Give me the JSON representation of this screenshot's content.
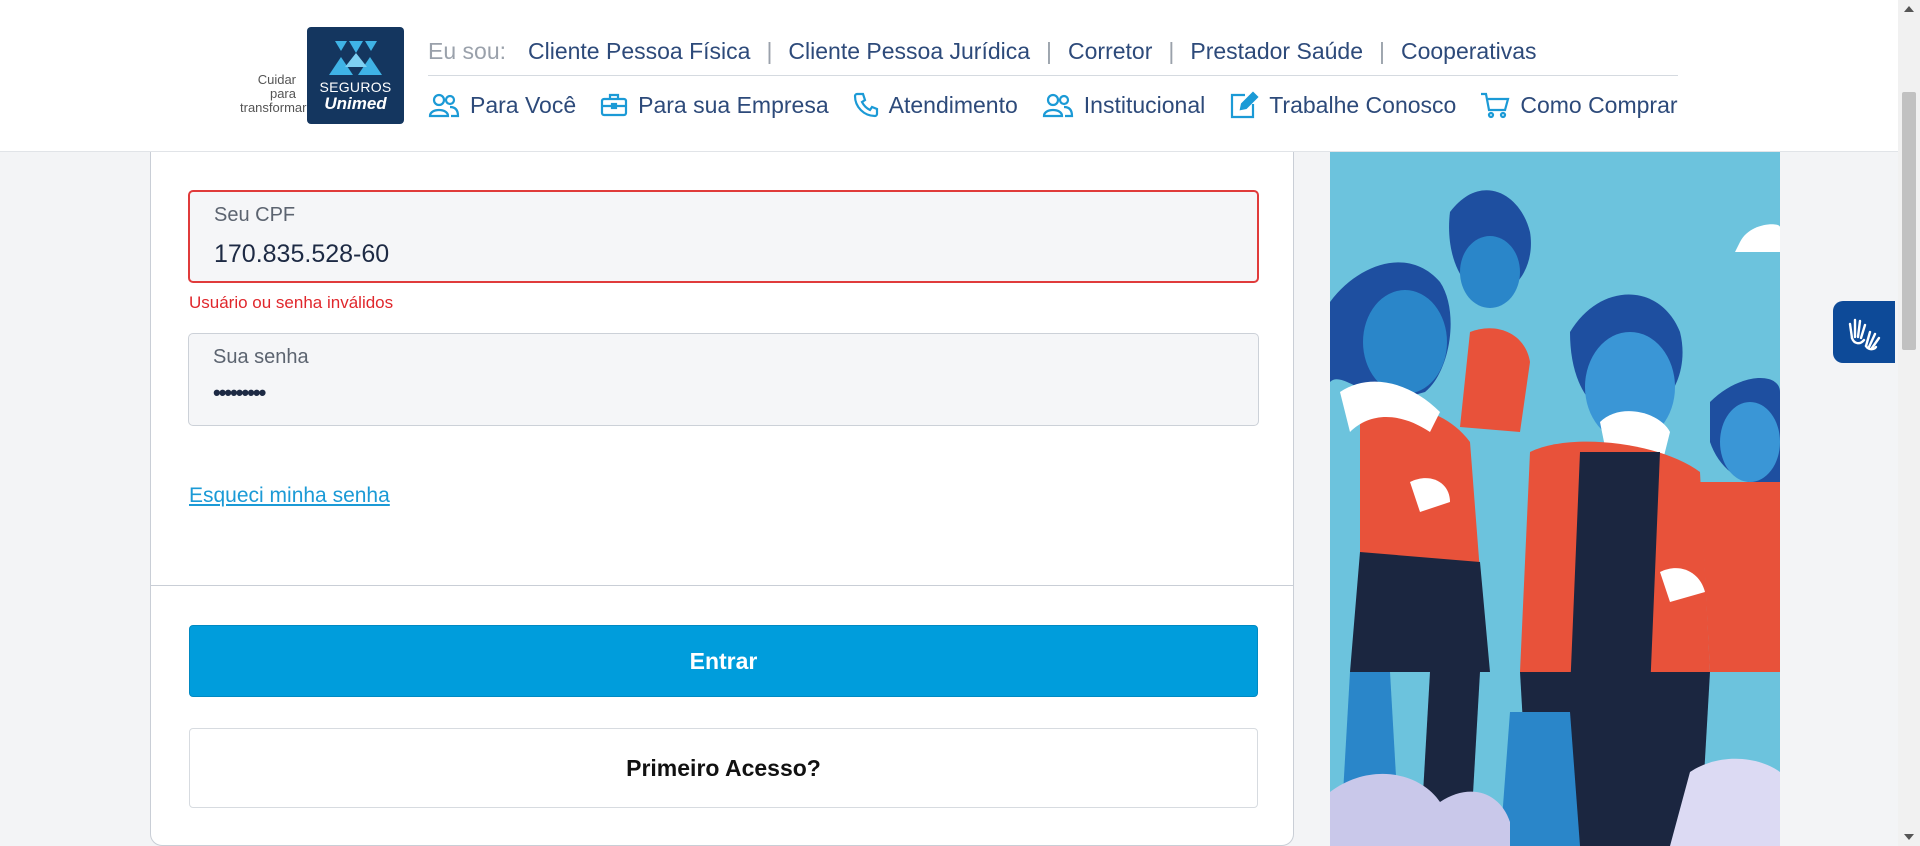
{
  "header": {
    "tagline": [
      "Cuidar",
      "para",
      "transformar"
    ],
    "logo": {
      "line1": "SEGUROS",
      "line2": "Unimed",
      "color": "#14365f"
    },
    "eu_sou": {
      "label": "Eu sou:",
      "links": [
        "Cliente Pessoa Física",
        "Cliente Pessoa Jurídica",
        "Corretor",
        "Prestador Saúde",
        "Cooperativas"
      ],
      "separator": "|"
    },
    "nav": [
      {
        "label": "Para Você",
        "icon": "users-icon"
      },
      {
        "label": "Para sua Empresa",
        "icon": "briefcase-icon"
      },
      {
        "label": "Atendimento",
        "icon": "phone-icon"
      },
      {
        "label": "Institucional",
        "icon": "users-icon"
      },
      {
        "label": "Trabalhe Conosco",
        "icon": "edit-icon"
      },
      {
        "label": "Como Comprar",
        "icon": "cart-icon"
      }
    ]
  },
  "form": {
    "cpf": {
      "label": "Seu CPF",
      "value": "170.835.528-60"
    },
    "error": "Usuário ou senha inválidos",
    "password": {
      "label": "Sua senha",
      "value": "•••••••••"
    },
    "forgot": "Esqueci minha senha",
    "submit": "Entrar",
    "first_access": "Primeiro Acesso?"
  },
  "colors": {
    "accent": "#009ddc",
    "error": "#e0272c",
    "navy": "#14365f",
    "illustration_bg": "#6cc3dd"
  },
  "accessibility": {
    "icon": "sign-language-icon"
  }
}
